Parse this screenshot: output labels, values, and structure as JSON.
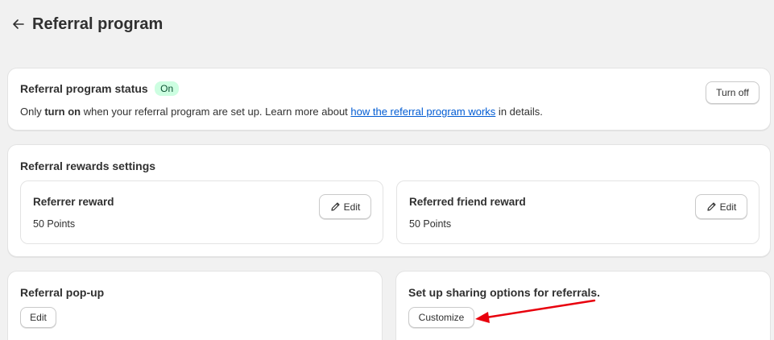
{
  "header": {
    "title": "Referral program",
    "back_icon": "arrow-left-icon"
  },
  "status_card": {
    "title": "Referral program status",
    "badge": "On",
    "desc_prefix": "Only ",
    "desc_bold": "turn on",
    "desc_middle": " when your referral program are set up. Learn more about ",
    "desc_link": "how the referral program works",
    "desc_suffix": " in details.",
    "button_label": "Turn off"
  },
  "rewards_card": {
    "title": "Referral rewards settings",
    "referrer": {
      "title": "Referrer reward",
      "value": "50 Points",
      "edit_label": "Edit"
    },
    "friend": {
      "title": "Referred friend reward",
      "value": "50 Points",
      "edit_label": "Edit"
    }
  },
  "popup_card": {
    "title": "Referral pop-up",
    "edit_label": "Edit"
  },
  "sharing_card": {
    "title": "Set up sharing options for referrals.",
    "button_label": "Customize"
  },
  "colors": {
    "annotation_arrow": "#e8000d",
    "badge_bg": "#cdfee1",
    "link": "#005bd3"
  }
}
